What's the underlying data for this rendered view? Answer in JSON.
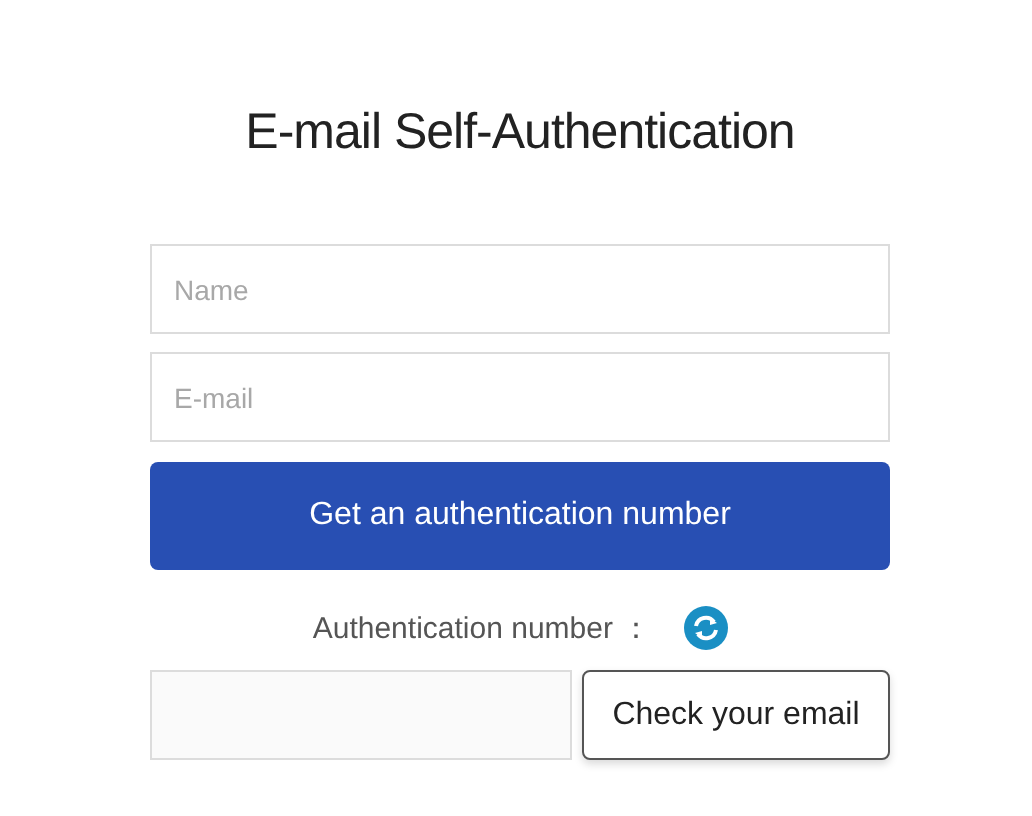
{
  "title": "E-mail Self-Authentication",
  "fields": [
    {
      "placeholder": "Name"
    },
    {
      "placeholder": "E-mail"
    }
  ],
  "submit_button": "Get an authentication number",
  "auth_label": "Authentication number ：",
  "check_button": "Check your email"
}
